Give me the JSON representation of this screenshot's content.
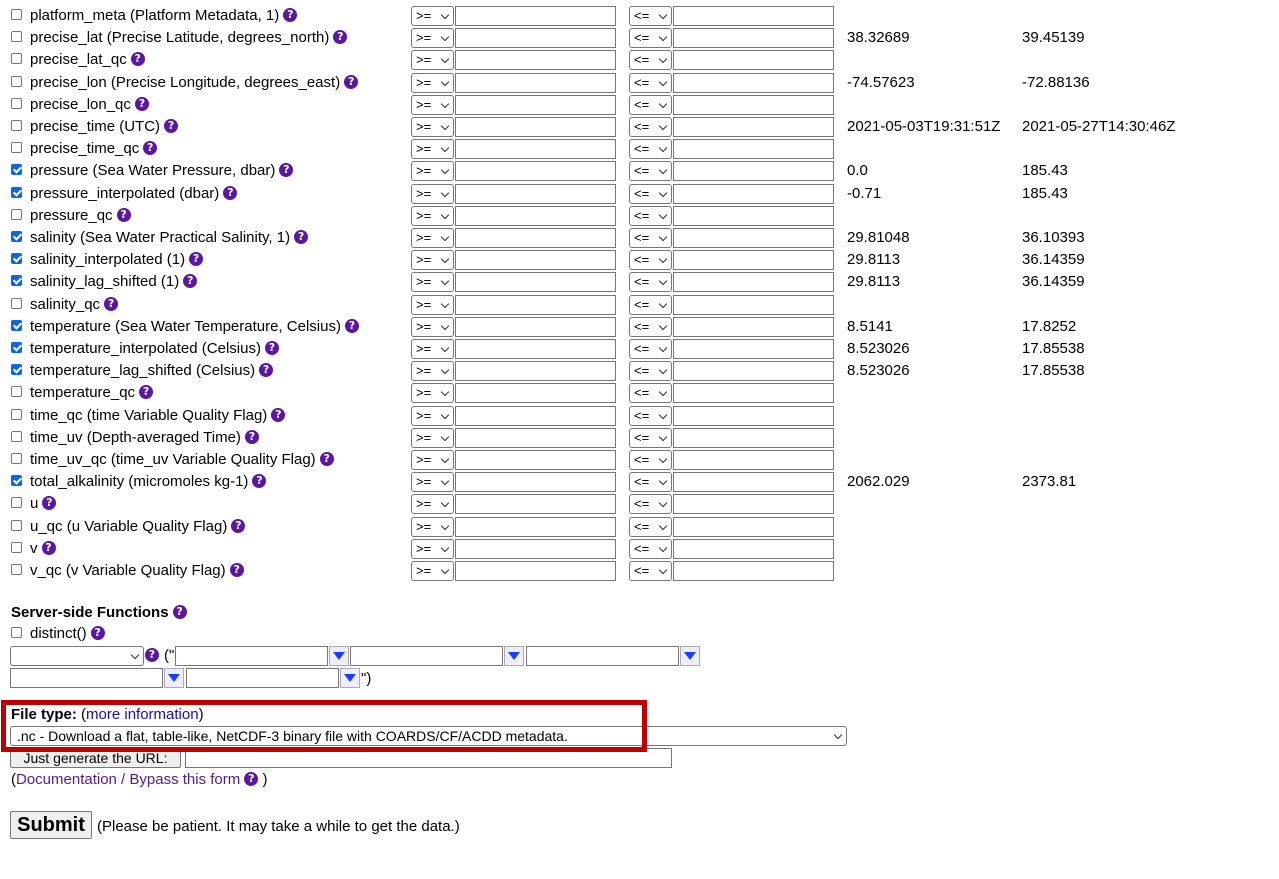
{
  "rows": [
    {
      "label": "platform_meta (Platform Metadata, 1)",
      "checked": false,
      "op_min": ">=",
      "op_max": "<=",
      "min": "",
      "max": ""
    },
    {
      "label": "precise_lat (Precise Latitude, degrees_north)",
      "checked": false,
      "op_min": ">=",
      "op_max": "<=",
      "min": "38.32689",
      "max": "39.45139"
    },
    {
      "label": "precise_lat_qc",
      "checked": false,
      "op_min": ">=",
      "op_max": "<=",
      "min": "",
      "max": ""
    },
    {
      "label": "precise_lon (Precise Longitude, degrees_east)",
      "checked": false,
      "op_min": ">=",
      "op_max": "<=",
      "min": "-74.57623",
      "max": "-72.88136"
    },
    {
      "label": "precise_lon_qc",
      "checked": false,
      "op_min": ">=",
      "op_max": "<=",
      "min": "",
      "max": ""
    },
    {
      "label": "precise_time (UTC)",
      "checked": false,
      "op_min": ">=",
      "op_max": "<=",
      "min": "2021-05-03T19:31:51Z",
      "max": "2021-05-27T14:30:46Z"
    },
    {
      "label": "precise_time_qc",
      "checked": false,
      "op_min": ">=",
      "op_max": "<=",
      "min": "",
      "max": ""
    },
    {
      "label": "pressure (Sea Water Pressure, dbar)",
      "checked": true,
      "op_min": ">=",
      "op_max": "<=",
      "min": "0.0",
      "max": "185.43"
    },
    {
      "label": "pressure_interpolated (dbar)",
      "checked": true,
      "op_min": ">=",
      "op_max": "<=",
      "min": "-0.71",
      "max": "185.43"
    },
    {
      "label": "pressure_qc",
      "checked": false,
      "op_min": ">=",
      "op_max": "<=",
      "min": "",
      "max": ""
    },
    {
      "label": "salinity (Sea Water Practical Salinity, 1)",
      "checked": true,
      "op_min": ">=",
      "op_max": "<=",
      "min": "29.81048",
      "max": "36.10393"
    },
    {
      "label": "salinity_interpolated (1)",
      "checked": true,
      "op_min": ">=",
      "op_max": "<=",
      "min": "29.8113",
      "max": "36.14359"
    },
    {
      "label": "salinity_lag_shifted (1)",
      "checked": true,
      "op_min": ">=",
      "op_max": "<=",
      "min": "29.8113",
      "max": "36.14359"
    },
    {
      "label": "salinity_qc",
      "checked": false,
      "op_min": ">=",
      "op_max": "<=",
      "min": "",
      "max": ""
    },
    {
      "label": "temperature (Sea Water Temperature, Celsius)",
      "checked": true,
      "op_min": ">=",
      "op_max": "<=",
      "min": "8.5141",
      "max": "17.8252"
    },
    {
      "label": "temperature_interpolated (Celsius)",
      "checked": true,
      "op_min": ">=",
      "op_max": "<=",
      "min": "8.523026",
      "max": "17.85538"
    },
    {
      "label": "temperature_lag_shifted (Celsius)",
      "checked": true,
      "op_min": ">=",
      "op_max": "<=",
      "min": "8.523026",
      "max": "17.85538"
    },
    {
      "label": "temperature_qc",
      "checked": false,
      "op_min": ">=",
      "op_max": "<=",
      "min": "",
      "max": ""
    },
    {
      "label": "time_qc (time Variable Quality Flag)",
      "checked": false,
      "op_min": ">=",
      "op_max": "<=",
      "min": "",
      "max": ""
    },
    {
      "label": "time_uv (Depth-averaged Time)",
      "checked": false,
      "op_min": ">=",
      "op_max": "<=",
      "min": "",
      "max": ""
    },
    {
      "label": "time_uv_qc (time_uv Variable Quality Flag)",
      "checked": false,
      "op_min": ">=",
      "op_max": "<=",
      "min": "",
      "max": ""
    },
    {
      "label": "total_alkalinity (micromoles kg-1)",
      "checked": true,
      "op_min": ">=",
      "op_max": "<=",
      "min": "2062.029",
      "max": "2373.81"
    },
    {
      "label": "u",
      "checked": false,
      "op_min": ">=",
      "op_max": "<=",
      "min": "",
      "max": ""
    },
    {
      "label": "u_qc (u Variable Quality Flag)",
      "checked": false,
      "op_min": ">=",
      "op_max": "<=",
      "min": "",
      "max": ""
    },
    {
      "label": "v",
      "checked": false,
      "op_min": ">=",
      "op_max": "<=",
      "min": "",
      "max": ""
    },
    {
      "label": "v_qc (v Variable Quality Flag)",
      "checked": false,
      "op_min": ">=",
      "op_max": "<=",
      "min": "",
      "max": ""
    }
  ],
  "help_glyph": "?",
  "server_functions": {
    "heading": "Server-side Functions",
    "distinct_label": "distinct()",
    "open_paren": "(\"",
    "close_paren": "\")"
  },
  "file_type": {
    "label": "File type:",
    "open": "(",
    "more_info": "more information",
    "close": ")",
    "selected": ".nc - Download a flat, table-like, NetCDF-3 binary file with COARDS/CF/ACDD metadata."
  },
  "generate_url_button": "Just generate the URL:",
  "docs": {
    "open": "(",
    "link": "Documentation / Bypass this form",
    "close": ")"
  },
  "submit": {
    "button": "Submit",
    "note": "(Please be patient. It may take a while to get the data.)"
  },
  "colors": {
    "highlight_border": "#c00000",
    "help_icon": "#5b17a0",
    "checkbox_checked": "#0b66e4"
  }
}
